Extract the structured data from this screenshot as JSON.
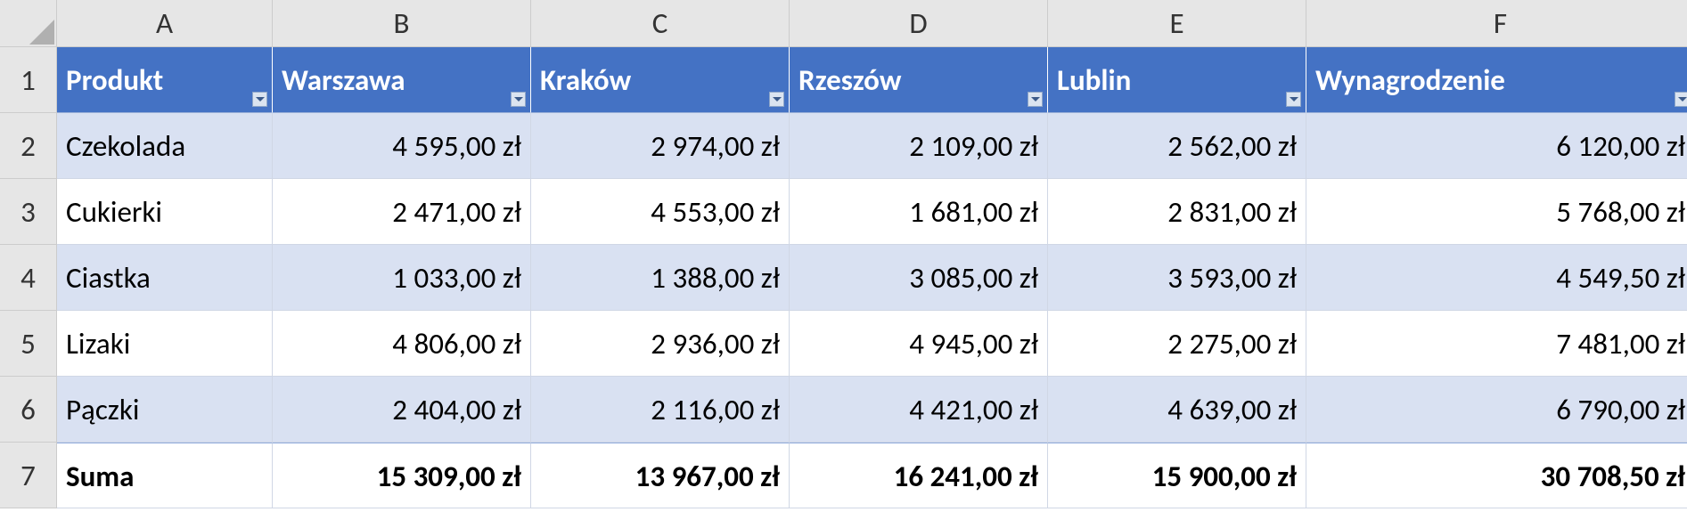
{
  "columnLetters": [
    "A",
    "B",
    "C",
    "D",
    "E",
    "F"
  ],
  "rowNumbers": [
    "1",
    "2",
    "3",
    "4",
    "5",
    "6",
    "7"
  ],
  "headers": {
    "A": "Produkt",
    "B": "Warszawa",
    "C": "Kraków",
    "D": "Rzeszów",
    "E": "Lublin",
    "F": "Wynagrodzenie"
  },
  "rows": [
    {
      "A": "Czekolada",
      "B": "4 595,00 zł",
      "C": "2 974,00 zł",
      "D": "2 109,00 zł",
      "E": "2 562,00 zł",
      "F": "6 120,00 zł"
    },
    {
      "A": "Cukierki",
      "B": "2 471,00 zł",
      "C": "4 553,00 zł",
      "D": "1 681,00 zł",
      "E": "2 831,00 zł",
      "F": "5 768,00 zł"
    },
    {
      "A": "Ciastka",
      "B": "1 033,00 zł",
      "C": "1 388,00 zł",
      "D": "3 085,00 zł",
      "E": "3 593,00 zł",
      "F": "4 549,50 zł"
    },
    {
      "A": "Lizaki",
      "B": "4 806,00 zł",
      "C": "2 936,00 zł",
      "D": "4 945,00 zł",
      "E": "2 275,00 zł",
      "F": "7 481,00 zł"
    },
    {
      "A": "Pączki",
      "B": "2 404,00 zł",
      "C": "2 116,00 zł",
      "D": "4 421,00 zł",
      "E": "4 639,00 zł",
      "F": "6 790,00 zł"
    }
  ],
  "total": {
    "A": "Suma",
    "B": "15 309,00 zł",
    "C": "13 967,00 zł",
    "D": "16 241,00 zł",
    "E": "15 900,00 zł",
    "F": "30 708,50 zł"
  }
}
